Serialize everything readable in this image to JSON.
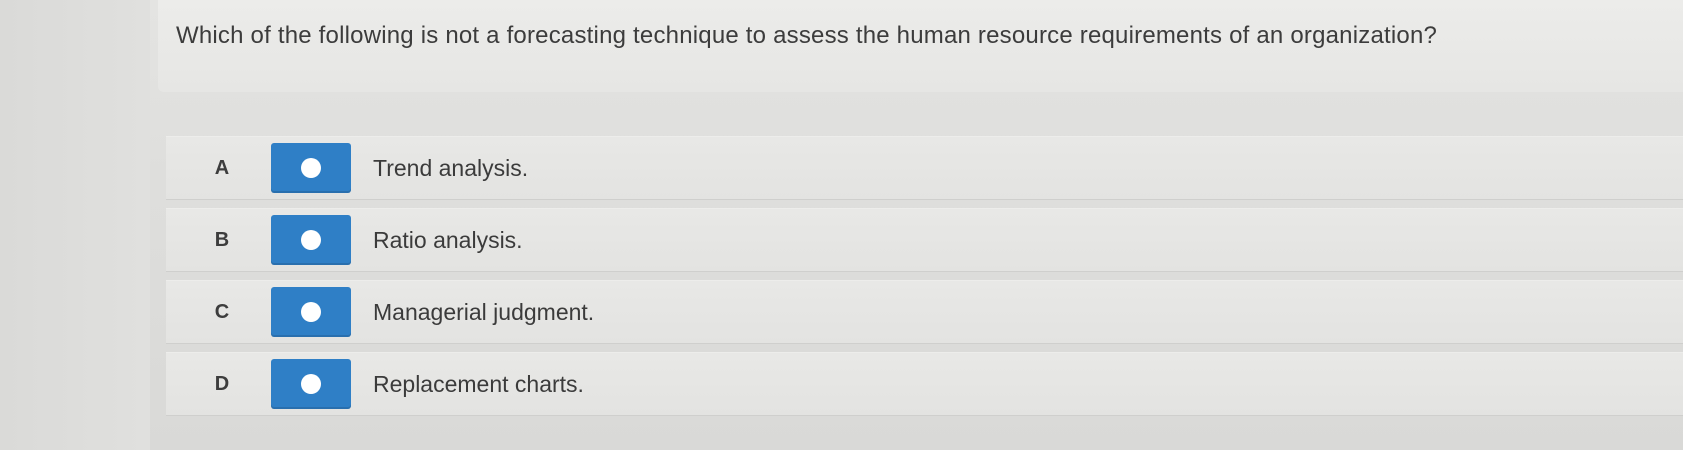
{
  "question": {
    "text": "Which of the following is not a forecasting technique to assess the human resource requirements of an organization?"
  },
  "options": [
    {
      "letter": "A",
      "label": "Trend analysis.",
      "selected": false
    },
    {
      "letter": "B",
      "label": "Ratio analysis.",
      "selected": false
    },
    {
      "letter": "C",
      "label": "Managerial judgment.",
      "selected": false
    },
    {
      "letter": "D",
      "label": "Replacement charts.",
      "selected": false
    }
  ],
  "colors": {
    "radio_button": "#2f7fc6",
    "radio_dot": "#ffffff",
    "text": "#3b3b3b",
    "background": "#e0e0de"
  }
}
